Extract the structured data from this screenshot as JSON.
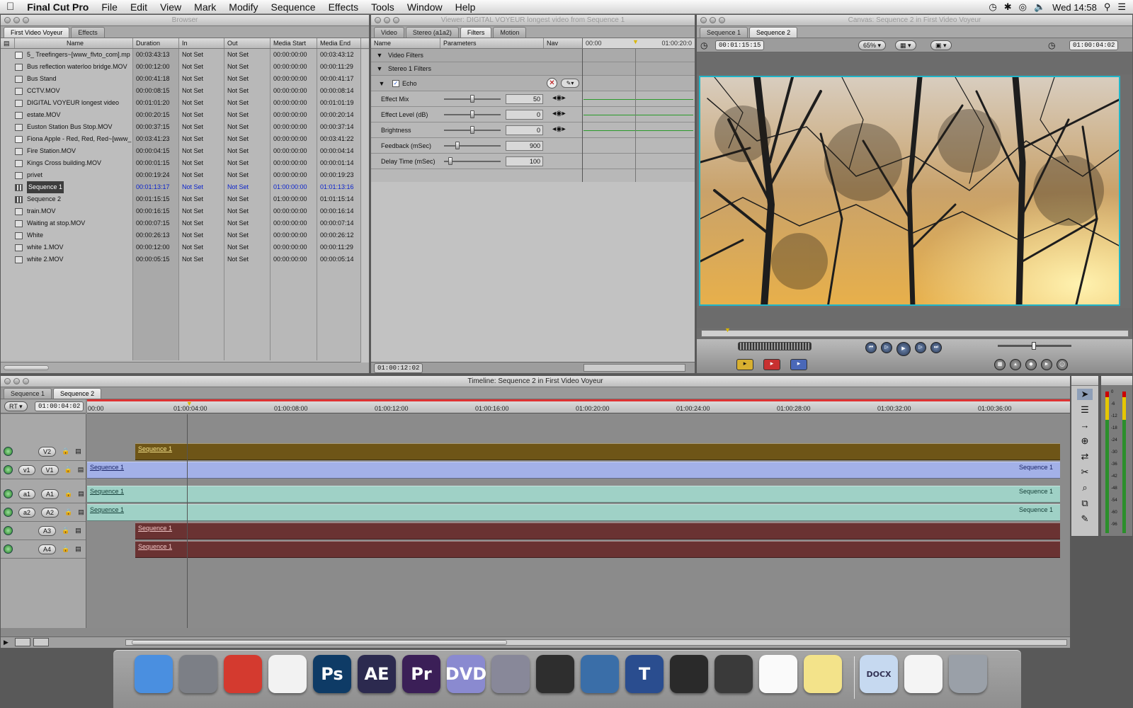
{
  "menubar": {
    "app": "Final Cut Pro",
    "items": [
      "File",
      "Edit",
      "View",
      "Mark",
      "Modify",
      "Sequence",
      "Effects",
      "Tools",
      "Window",
      "Help"
    ],
    "clock": "Wed 14:58"
  },
  "browser": {
    "title": "Browser",
    "tabs": [
      "First Video Voyeur",
      "Effects"
    ],
    "columns": [
      "Name",
      "Duration",
      "In",
      "Out",
      "Media Start",
      "Media End"
    ],
    "rows": [
      {
        "icon": "audio",
        "name": "5_ Treefingers~[www_flvto_com].mp",
        "duration": "00:03:43:13",
        "in": "Not Set",
        "out": "Not Set",
        "start": "00:00:00:00",
        "end": "00:03:43:12"
      },
      {
        "icon": "clip",
        "name": "Bus reflection waterloo bridge.MOV",
        "duration": "00:00:12:00",
        "in": "Not Set",
        "out": "Not Set",
        "start": "00:00:00:00",
        "end": "00:00:11:29"
      },
      {
        "icon": "clip",
        "name": "Bus Stand",
        "duration": "00:00:41:18",
        "in": "Not Set",
        "out": "Not Set",
        "start": "00:00:00:00",
        "end": "00:00:41:17"
      },
      {
        "icon": "clip",
        "name": "CCTV.MOV",
        "duration": "00:00:08:15",
        "in": "Not Set",
        "out": "Not Set",
        "start": "00:00:00:00",
        "end": "00:00:08:14"
      },
      {
        "icon": "clip",
        "name": "DIGITAL VOYEUR longest video",
        "duration": "00:01:01:20",
        "in": "Not Set",
        "out": "Not Set",
        "start": "00:00:00:00",
        "end": "00:01:01:19"
      },
      {
        "icon": "clip",
        "name": "estate.MOV",
        "duration": "00:00:20:15",
        "in": "Not Set",
        "out": "Not Set",
        "start": "00:00:00:00",
        "end": "00:00:20:14"
      },
      {
        "icon": "clip",
        "name": "Euston Station Bus Stop.MOV",
        "duration": "00:00:37:15",
        "in": "Not Set",
        "out": "Not Set",
        "start": "00:00:00:00",
        "end": "00:00:37:14"
      },
      {
        "icon": "audio",
        "name": "Fiona Apple - Red, Red, Red~[www_",
        "duration": "00:03:41:23",
        "in": "Not Set",
        "out": "Not Set",
        "start": "00:00:00:00",
        "end": "00:03:41:22"
      },
      {
        "icon": "clip",
        "name": "Fire Station.MOV",
        "duration": "00:00:04:15",
        "in": "Not Set",
        "out": "Not Set",
        "start": "00:00:00:00",
        "end": "00:00:04:14"
      },
      {
        "icon": "clip",
        "name": "Kings Cross building.MOV",
        "duration": "00:00:01:15",
        "in": "Not Set",
        "out": "Not Set",
        "start": "00:00:00:00",
        "end": "00:00:01:14"
      },
      {
        "icon": "clip",
        "name": "privet",
        "duration": "00:00:19:24",
        "in": "Not Set",
        "out": "Not Set",
        "start": "00:00:00:00",
        "end": "00:00:19:23"
      },
      {
        "icon": "seq",
        "name": "Sequence 1",
        "duration": "00:01:13:17",
        "in": "Not Set",
        "out": "Not Set",
        "start": "01:00:00:00",
        "end": "01:01:13:16",
        "selected": true
      },
      {
        "icon": "seq",
        "name": "Sequence 2",
        "duration": "00:01:15:15",
        "in": "Not Set",
        "out": "Not Set",
        "start": "01:00:00:00",
        "end": "01:01:15:14"
      },
      {
        "icon": "clip",
        "name": "train.MOV",
        "duration": "00:00:16:15",
        "in": "Not Set",
        "out": "Not Set",
        "start": "00:00:00:00",
        "end": "00:00:16:14"
      },
      {
        "icon": "clip",
        "name": "Waiting at stop.MOV",
        "duration": "00:00:07:15",
        "in": "Not Set",
        "out": "Not Set",
        "start": "00:00:00:00",
        "end": "00:00:07:14"
      },
      {
        "icon": "clip",
        "name": "White",
        "duration": "00:00:26:13",
        "in": "Not Set",
        "out": "Not Set",
        "start": "00:00:00:00",
        "end": "00:00:26:12"
      },
      {
        "icon": "clip",
        "name": "white 1.MOV",
        "duration": "00:00:12:00",
        "in": "Not Set",
        "out": "Not Set",
        "start": "00:00:00:00",
        "end": "00:00:11:29"
      },
      {
        "icon": "clip",
        "name": "white 2.MOV",
        "duration": "00:00:05:15",
        "in": "Not Set",
        "out": "Not Set",
        "start": "00:00:00:00",
        "end": "00:00:05:14"
      }
    ]
  },
  "viewer": {
    "title": "Viewer: DIGITAL VOYEUR longest video from Sequence 1",
    "tabs": [
      "Video",
      "Stereo (a1a2)",
      "Filters",
      "Motion"
    ],
    "columns": {
      "name": "Name",
      "params": "Parameters",
      "nav": "Nav"
    },
    "ruler": {
      "start": "00:00",
      "end": "01:00:20:0"
    },
    "groups": [
      "Video Filters",
      "Stereo 1 Filters"
    ],
    "filter": "Echo",
    "params": [
      {
        "name": "Effect Mix",
        "value": "50",
        "pos": 0.5
      },
      {
        "name": "Effect Level (dB)",
        "value": "0",
        "pos": 0.5
      },
      {
        "name": "Brightness",
        "value": "0",
        "pos": 0.5
      },
      {
        "name": "Feedback (mSec)",
        "value": "900",
        "pos": 0.22
      },
      {
        "name": "Delay Time (mSec)",
        "value": "100",
        "pos": 0.08
      }
    ],
    "timecode": "01:00:12:02"
  },
  "canvas": {
    "title": "Canvas: Sequence 2 in First Video Voyeur",
    "tabs": [
      "Sequence 1",
      "Sequence 2"
    ],
    "duration": "00:01:15:15",
    "zoom": "65%",
    "current": "01:00:04:02"
  },
  "timeline": {
    "title": "Timeline: Sequence 2 in First Video Voyeur",
    "tabs": [
      "Sequence 1",
      "Sequence 2"
    ],
    "rt": "RT",
    "current": "01:00:04:02",
    "ruler": [
      "00:00",
      "01:00:04:00",
      "01:00:08:00",
      "01:00:12:00",
      "01:00:16:00",
      "01:00:20:00",
      "01:00:24:00",
      "01:00:28:00",
      "01:00:32:00",
      "01:00:36:00"
    ],
    "tracks": [
      {
        "src": "",
        "dst": "V2",
        "clips": [
          {
            "label": "Sequence 1",
            "start": 0.0495,
            "end": 1,
            "color": "#6e5517",
            "tcolor": "#f2e08a"
          }
        ]
      },
      {
        "src": "v1",
        "dst": "V1",
        "clips": [
          {
            "label": "Sequence 1",
            "start": 0,
            "end": 1,
            "color": "#a3b1e8",
            "tcolor": "#1a2466",
            "endlabel": "Sequence 1"
          }
        ]
      },
      {
        "src": "a1",
        "dst": "A1",
        "clips": [
          {
            "label": "Sequence 1",
            "start": 0,
            "end": 1,
            "color": "#9fd1c6",
            "tcolor": "#143d36",
            "endlabel": "Sequence 1"
          }
        ]
      },
      {
        "src": "a2",
        "dst": "A2",
        "clips": [
          {
            "label": "Sequence 1",
            "start": 0,
            "end": 1,
            "color": "#9fd1c6",
            "tcolor": "#143d36",
            "endlabel": "Sequence 1"
          }
        ]
      },
      {
        "src": "",
        "dst": "A3",
        "clips": [
          {
            "label": "Sequence 1",
            "start": 0.0495,
            "end": 1,
            "color": "#6a3232",
            "tcolor": "#f1c7c7"
          }
        ]
      },
      {
        "src": "",
        "dst": "A4",
        "clips": [
          {
            "label": "Sequence 1",
            "start": 0.0495,
            "end": 1,
            "color": "#6a3232",
            "tcolor": "#f1c7c7"
          }
        ]
      }
    ],
    "playhead": 0.1025
  },
  "meter": {
    "labels": [
      "0",
      "-6",
      "-12",
      "-18",
      "-24",
      "-30",
      "-36",
      "-42",
      "-48",
      "-54",
      "-60",
      "-96"
    ]
  },
  "dock": [
    {
      "name": "finder",
      "label": "",
      "color": "#4a8fe0"
    },
    {
      "name": "launchpad",
      "label": "",
      "color": "#7c7f86"
    },
    {
      "name": "chrome",
      "label": "",
      "color": "#d43a2f"
    },
    {
      "name": "photos",
      "label": "",
      "color": "#f2f2f2"
    },
    {
      "name": "photoshop",
      "label": "Ps",
      "color": "#0e3b66"
    },
    {
      "name": "after-effects",
      "label": "AE",
      "color": "#2c2a4f"
    },
    {
      "name": "premiere",
      "label": "Pr",
      "color": "#3b1f57"
    },
    {
      "name": "dvd-player",
      "label": "DVD",
      "color": "#8a8ad0"
    },
    {
      "name": "compressor",
      "label": "",
      "color": "#889"
    },
    {
      "name": "color",
      "label": "",
      "color": "#2e2e2e"
    },
    {
      "name": "motion",
      "label": "",
      "color": "#3a6ea8"
    },
    {
      "name": "livetype",
      "label": "T",
      "color": "#2a4d8f"
    },
    {
      "name": "soundtrack",
      "label": "",
      "color": "#2a2a2a"
    },
    {
      "name": "final-cut",
      "label": "",
      "color": "#3a3a3a"
    },
    {
      "name": "reminders",
      "label": "",
      "color": "#fafafa"
    },
    {
      "name": "stickies",
      "label": "",
      "color": "#f3e38a"
    },
    {
      "name": "docx",
      "label": "DOCX",
      "color": "#c6d9f0"
    },
    {
      "name": "document",
      "label": "",
      "color": "#f4f4f4"
    },
    {
      "name": "trash",
      "label": "",
      "color": "#9aa0a8"
    }
  ]
}
